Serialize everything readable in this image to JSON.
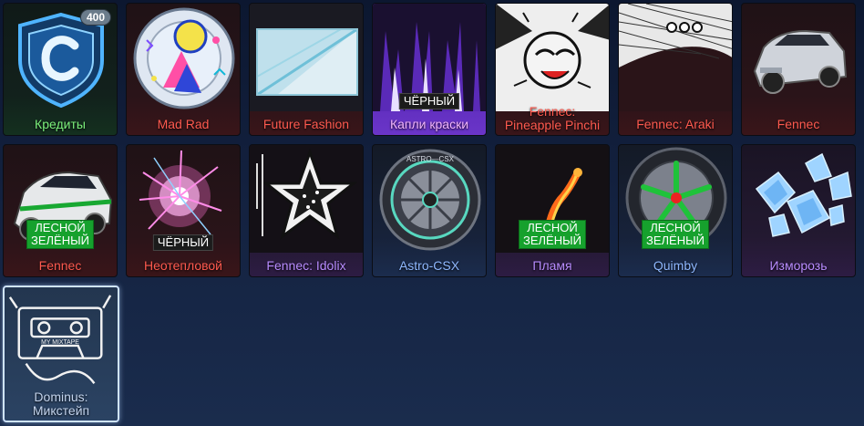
{
  "items": [
    {
      "name": "Кредиты",
      "badge": "400"
    },
    {
      "name": "Mad Rad"
    },
    {
      "name": "Future Fashion"
    },
    {
      "name": "Капли краски",
      "paint": "ЧЁРНЫЙ"
    },
    {
      "name_line1": "Fennec:",
      "name_line2": "Pineapple Pinchi"
    },
    {
      "name": "Fennec: Araki"
    },
    {
      "name": "Fennec"
    },
    {
      "name": "Fennec",
      "paint_line1": "ЛЕСНОЙ",
      "paint_line2": "ЗЕЛЁНЫЙ"
    },
    {
      "name": "Неотепловой",
      "paint": "ЧЁРНЫЙ"
    },
    {
      "name": "Fennec: Idolix"
    },
    {
      "name": "Astro-CSX",
      "art_text": "ASTRO—CSX"
    },
    {
      "name": "Пламя",
      "paint_line1": "ЛЕСНОЙ",
      "paint_line2": "ЗЕЛЁНЫЙ"
    },
    {
      "name": "Quimby",
      "paint_line1": "ЛЕСНОЙ",
      "paint_line2": "ЗЕЛЁНЫЙ"
    },
    {
      "name": "Изморозь"
    },
    {
      "name_line1": "Dominus:",
      "name_line2": "Микстейп",
      "art_text": "MY MIXTAPE"
    }
  ],
  "colors": {
    "import": "#ff5a4f",
    "exotic": "#f0d94a",
    "very_rare": "#b88cff",
    "rare": "#8fb8ff",
    "green_paint": "#16a12d",
    "premium": "#5a2ab8",
    "selected_border": "#cfe4ff"
  }
}
